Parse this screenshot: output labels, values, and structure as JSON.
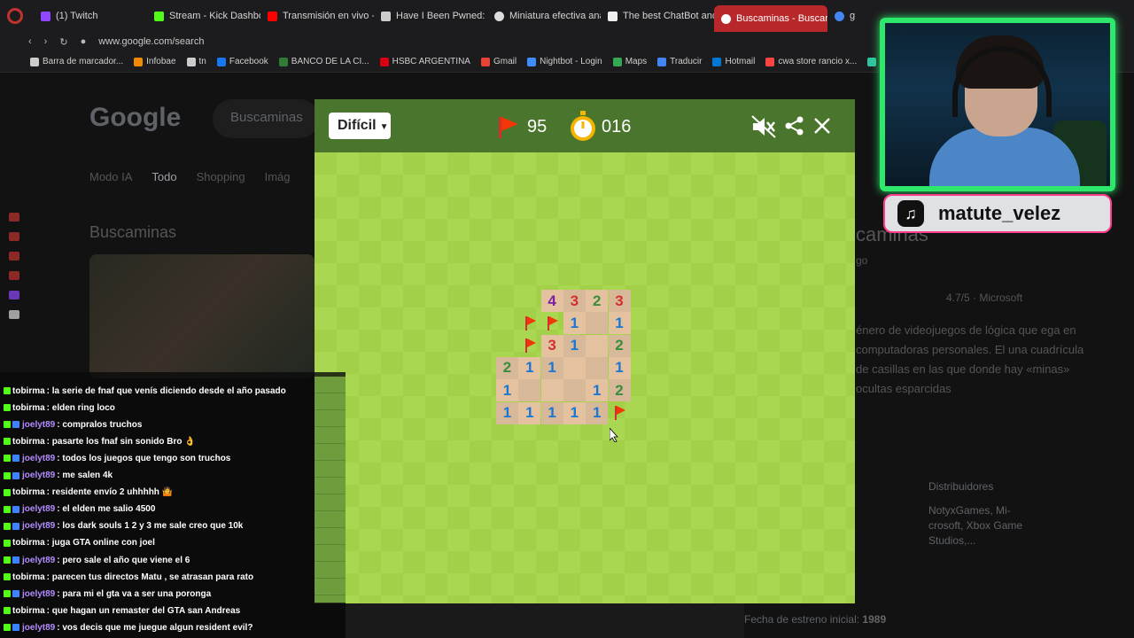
{
  "browser": {
    "tabs": [
      {
        "label": "(1) Twitch",
        "color": "#9146ff"
      },
      {
        "label": "Stream - Kick Dashboard",
        "color": "#53fc18"
      },
      {
        "label": "Transmisión en vivo - You",
        "color": "#ff0000"
      },
      {
        "label": "Have I Been Pwned: Dox",
        "color": "#cccccc"
      },
      {
        "label": "Miniatura efectiva análisis",
        "color": "#dddddd"
      },
      {
        "label": "The best ChatBot and Wi",
        "color": "#eeeeee"
      },
      {
        "label": "Buscaminas - Buscar con",
        "color": "#ffffff"
      },
      {
        "label": "g",
        "color": "#4285f4"
      }
    ],
    "url": "www.google.com/search",
    "bookmarks": [
      {
        "label": "Barra de marcador...",
        "color": "#cccccc"
      },
      {
        "label": "Infobae",
        "color": "#f08a00"
      },
      {
        "label": "tn",
        "color": "#cccccc"
      },
      {
        "label": "Facebook",
        "color": "#1877f2"
      },
      {
        "label": "BANCO DE LA CI...",
        "color": "#2e7d32"
      },
      {
        "label": "HSBC ARGENTINA",
        "color": "#db0011"
      },
      {
        "label": "Gmail",
        "color": "#ea4335"
      },
      {
        "label": "Nightbot - Login",
        "color": "#3c8dff"
      },
      {
        "label": "Maps",
        "color": "#34a853"
      },
      {
        "label": "Traducir",
        "color": "#4285f4"
      },
      {
        "label": "Hotmail",
        "color": "#0078d4"
      },
      {
        "label": "cwa store rancio x...",
        "color": "#ff4444"
      },
      {
        "label": "Streamlabs",
        "color": "#31c3a2"
      },
      {
        "label": "St",
        "color": "#ff4444"
      }
    ]
  },
  "google": {
    "logo": "Google",
    "search_value": "Buscaminas",
    "nav": [
      "Modo IA",
      "Todo",
      "Shopping",
      "Imág"
    ],
    "title": "Buscaminas",
    "rp_title": "caminas",
    "rp_dev": "go",
    "rp_rating": "4.7/5 · Microsoft",
    "rp_desc": "énero de videojuegos de lógica que ega en computadoras personales. El una cuadrícula de casillas en las que donde hay «minas» ocultas esparcidas",
    "distributors_label": "Distribuidores",
    "distributors": "NotyxGames, Mi-crosoft, Xbox Game Studios,...",
    "release_label": "Fecha de estreno inicial:",
    "release_value": "1989"
  },
  "minesweeper": {
    "difficulty": "Difícil",
    "flags": "95",
    "timer": "016",
    "colors": {
      "header": "#4a752c",
      "light": "#aad751",
      "dark": "#a2d149",
      "revealed": "#e5c29f"
    }
  },
  "streamer": {
    "tiktok_handle": "matute_velez"
  },
  "chat": [
    {
      "user": "tobirma",
      "msg": ": la serie de fnaf que venís diciendo desde el año pasado",
      "kind": "t"
    },
    {
      "user": "tobirma",
      "msg": ": elden ring loco",
      "kind": "t"
    },
    {
      "user": "joelyt89",
      "msg": ": compralos truchos",
      "kind": "j"
    },
    {
      "user": "tobirma",
      "msg": ": pasarte los fnaf sin sonido Bro 👌",
      "kind": "t"
    },
    {
      "user": "joelyt89",
      "msg": ": todos los juegos que tengo son truchos",
      "kind": "j"
    },
    {
      "user": "joelyt89",
      "msg": ": me salen 4k",
      "kind": "j"
    },
    {
      "user": "tobirma",
      "msg": ": residente envío 2 uhhhhh 🤷",
      "kind": "t"
    },
    {
      "user": "joelyt89",
      "msg": ": el elden me salio 4500",
      "kind": "j"
    },
    {
      "user": "joelyt89",
      "msg": ": los dark souls 1 2 y 3 me sale creo que 10k",
      "kind": "j"
    },
    {
      "user": "tobirma",
      "msg": ": juga GTA online con joel",
      "kind": "t"
    },
    {
      "user": "joelyt89",
      "msg": ": pero sale el año que viene el 6",
      "kind": "j"
    },
    {
      "user": "tobirma",
      "msg": ": parecen tus directos Matu , se atrasan para rato",
      "kind": "t"
    },
    {
      "user": "joelyt89",
      "msg": ": para mi el gta va a ser una poronga",
      "kind": "j"
    },
    {
      "user": "tobirma",
      "msg": ": que hagan un remaster del GTA san Andreas",
      "kind": "t"
    },
    {
      "user": "joelyt89",
      "msg": ": vos decis que me juegue algun resident evil?",
      "kind": "j"
    }
  ]
}
